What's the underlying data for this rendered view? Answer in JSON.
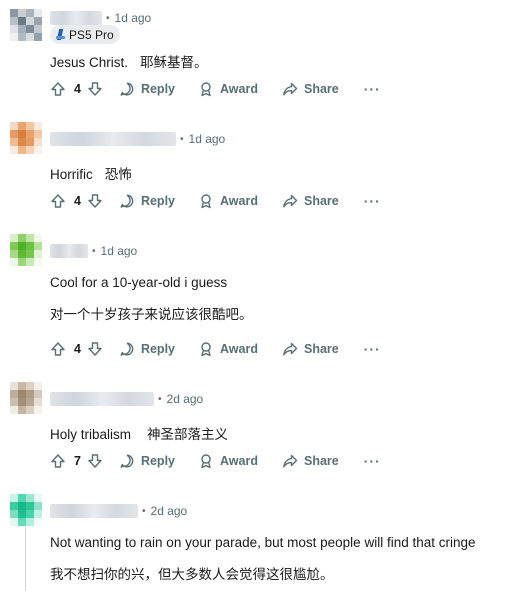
{
  "comments": [
    {
      "time": "1d ago",
      "flair": "PS5 Pro",
      "text_en": "Jesus Christ.",
      "text_cn": "耶稣基督。",
      "votes": "4",
      "avatar_colors": [
        "#8b98a4",
        "#c7cdd3",
        "#a9b3bc",
        "#e8ebee",
        "#b7c0c8",
        "#6d7b88",
        "#d3d8dd",
        "#9aa6b1",
        "#dfe3e7",
        "#a4afb9",
        "#7f8c98",
        "#c2c9cf",
        "#eef0f2",
        "#b0bac3",
        "#d9dde1",
        "#95a1ac"
      ]
    },
    {
      "time": "1d ago",
      "flair": "",
      "text_en": "Horrific",
      "text_cn": "恐怖",
      "votes": "4",
      "avatar_colors": [
        "#f6d9c2",
        "#e9a46f",
        "#f2c6a3",
        "#fbe9dc",
        "#e49a62",
        "#d97f3c",
        "#e8a26c",
        "#f4c9a5",
        "#f1bb8f",
        "#dc8a4c",
        "#e59b63",
        "#f8dfca",
        "#fbeadf",
        "#f0b88b",
        "#f6d4b7",
        "#fdf2ea"
      ]
    },
    {
      "time": "1d ago",
      "flair": "",
      "text_en": "Cool for a 10-year-old i guess",
      "text_cn": "对一个十岁孩子来说应该很酷吧。",
      "votes": "4",
      "avatar_colors": [
        "#d7f0c8",
        "#8ed16b",
        "#bfe5a8",
        "#f1f9ec",
        "#7fc955",
        "#4fb12a",
        "#6cc143",
        "#b4e09a",
        "#a8da8a",
        "#5cba34",
        "#77c64f",
        "#def3d2",
        "#eef8e8",
        "#9cd57c",
        "#c9eab6",
        "#f6fbf2"
      ]
    },
    {
      "time": "2d ago",
      "flair": "",
      "text_en": "Holy tribalism",
      "text_cn": "神圣部落主义",
      "votes": "7",
      "avatar_colors": [
        "#e9e2da",
        "#c9b8a6",
        "#ddd1c4",
        "#f3efea",
        "#bfae9b",
        "#9c8771",
        "#b09d88",
        "#d6cabd",
        "#ccbfb1",
        "#a48f7a",
        "#b8a692",
        "#e6ddd3",
        "#f1ece6",
        "#c4b4a2",
        "#d9cec2",
        "#f6f3ef"
      ]
    },
    {
      "time": "2d ago",
      "flair": "",
      "text_en": "Not wanting to rain on your parade, but most people will find that cringe",
      "text_cn": "我不想扫你的兴，但大多数人会觉得这很尴尬。",
      "votes": "",
      "avatar_colors": [
        "#c8f3e7",
        "#4fd8b2",
        "#9be8d1",
        "#e9faf5",
        "#38cfa4",
        "#16b985",
        "#2cc797",
        "#8ee3ca",
        "#7adfc1",
        "#1fbe8e",
        "#45d3aa",
        "#c1f1e3",
        "#e3f8f2",
        "#66dab8",
        "#b3eedc",
        "#f3fcf9"
      ]
    }
  ],
  "actions": {
    "reply": "Reply",
    "award": "Award",
    "share": "Share",
    "more": "···"
  },
  "colors": {
    "meta": "#576f76",
    "text": "#1a1a1b",
    "flair_bg": "#eaedef"
  }
}
